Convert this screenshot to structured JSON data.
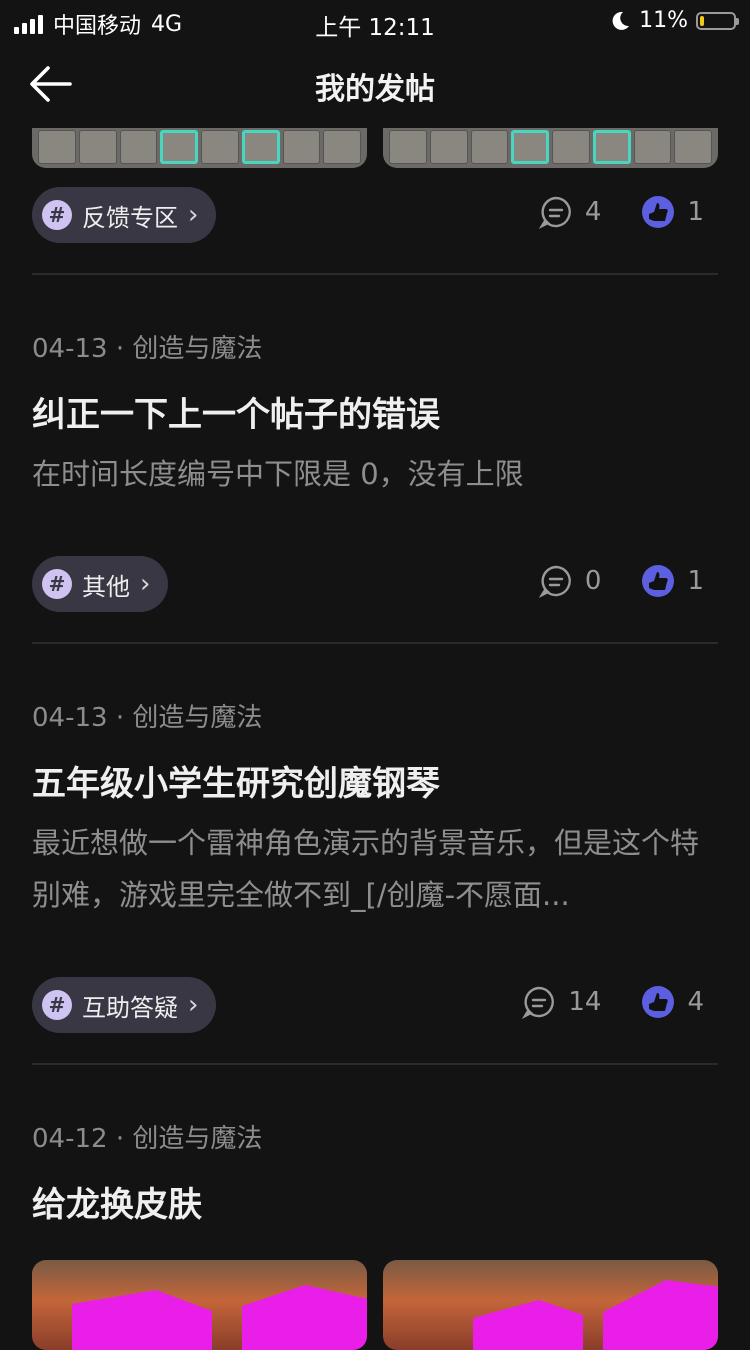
{
  "status_bar": {
    "carrier": "中国移动",
    "network": "4G",
    "time": "上午 12:11",
    "battery": "11%",
    "battery_level": 0.11
  },
  "nav": {
    "title": "我的发帖"
  },
  "first_post": {
    "tag": "反馈专区",
    "comments": "4",
    "likes": "1"
  },
  "posts": [
    {
      "date": "04-13",
      "category": "· 创造与魔法",
      "title": "纠正一下上一个帖子的错误",
      "excerpt": "在时间长度编号中下限是 0，没有上限",
      "tag": "其他",
      "comments": "0",
      "likes": "1"
    },
    {
      "date": "04-13",
      "category": "· 创造与魔法",
      "title": "五年级小学生研究创魔钢琴",
      "excerpt": "最近想做一个雷神角色演示的背景音乐，但是这个特别难，游戏里完全做不到_[/创魔-不愿面...",
      "tag": "互助答疑",
      "comments": "14",
      "likes": "4"
    },
    {
      "date": "04-12",
      "category": "· 创造与魔法",
      "title": "给龙换皮肤"
    }
  ],
  "colors": {
    "background": "#131313",
    "tag_bg": "#3a3745",
    "hash_badge": "#cfc3f1",
    "like_icon": "#5b5fe0",
    "battery_fill": "#f5c518"
  }
}
